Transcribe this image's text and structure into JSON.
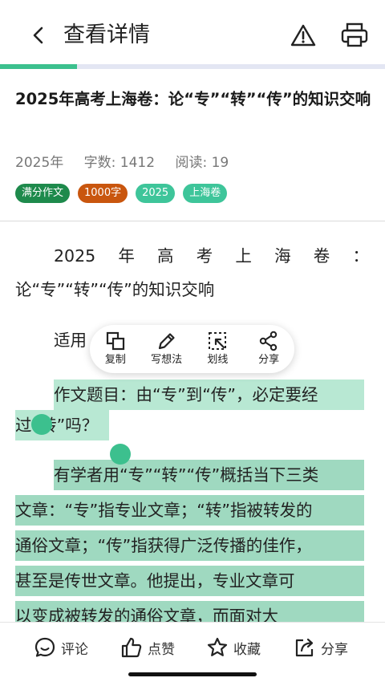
{
  "header": {
    "title": "查看详情",
    "back_icon": "back-chevron-icon",
    "report_icon": "warning-triangle-icon",
    "print_icon": "printer-icon"
  },
  "reading_progress": 0.2,
  "article": {
    "title": "2025年高考上海卷：论“专”“转”“传”的知识交响",
    "year": "2025年",
    "word_count": "字数: 1412",
    "reads": "阅读: 19",
    "tags": [
      {
        "label": "满分作文",
        "color": "#1e8a4c"
      },
      {
        "label": "1000字",
        "color": "#c9560e"
      },
      {
        "label": "2025",
        "color": "#3ec59a"
      },
      {
        "label": "上海卷",
        "color": "#3ec59a"
      }
    ]
  },
  "content": {
    "heading_line1": [
      "2025",
      "年",
      "高",
      "考",
      "上",
      "海",
      "卷",
      "："
    ],
    "heading_line2": "论“专”“转”“传”的知识交响",
    "applicable_fragment": "适用",
    "topic_line1": "作文题目：由“专”到“传”，必定要经",
    "topic_line2": "过“转”吗？",
    "para_line1": "有学者用“专”“转”“传”概括当下三类",
    "para_line2": "文章：“专”指专业文章；“转”指被转发的",
    "para_line3": "通俗文章；“传”指获得广泛传播的佳作，",
    "para_line4": "甚至是传世文章。他提出，专业文章可",
    "para_line5": "以变成被转发的通俗文章，而面对大"
  },
  "selection_toolbar": {
    "items": [
      {
        "label": "复制",
        "icon": "copy-icon"
      },
      {
        "label": "写想法",
        "icon": "pen-icon"
      },
      {
        "label": "划线",
        "icon": "underline-select-icon"
      },
      {
        "label": "分享",
        "icon": "share-nodes-icon"
      }
    ]
  },
  "bottom_bar": {
    "comment": "评论",
    "like": "点赞",
    "favorite": "收藏",
    "share": "分享"
  },
  "colors": {
    "accent": "#3cc08e",
    "highlight_light": "#b8e8d3",
    "highlight_dark": "#9fd9c0"
  }
}
